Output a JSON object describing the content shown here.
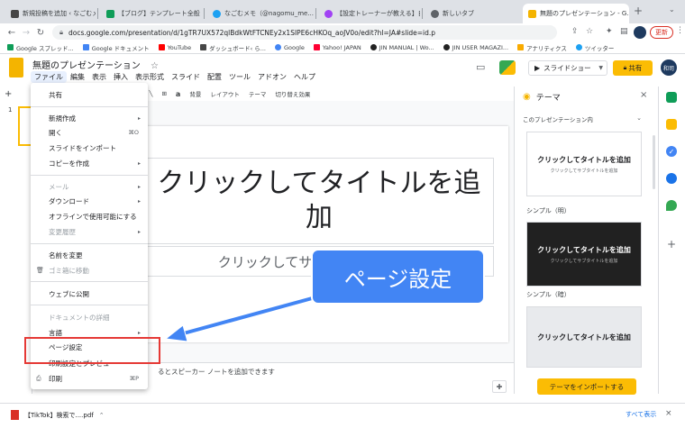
{
  "browser": {
    "tabs": [
      {
        "label": "新規投稿を追加 ‹ なごむメモ —",
        "color": "#464646"
      },
      {
        "label": "【ブログ】テンプレート全般 - ...",
        "color": "#0f9d58"
      },
      {
        "label": "なごむメモ（@nagomu_me...",
        "color": "#1da1f2"
      },
      {
        "label": "【設定トレーナーが教える】自...",
        "color": "#a142f4"
      },
      {
        "label": "新しいタブ",
        "color": "#5f6368"
      },
      {
        "label": "無題のプレゼンテーション - G...",
        "color": "#f4b400"
      }
    ],
    "new_tab": "+",
    "url": "docs.google.com/presentation/d/1gTR7UX572qlBdkWtFTCNEy2x1SIPE6cHKOq_aoJV0o/edit?hl=JA#slide=id.p",
    "update_label": "更新",
    "bookmarks": [
      "Google スプレッド...",
      "Google ドキュメント",
      "YouTube",
      "ダッシュボード‹ ら...",
      "Google",
      "Yahoo! JAPAN",
      "JIN MANUAL | Wo...",
      "JIN USER MAGAZI...",
      "アナリティクス",
      "ツイッター"
    ]
  },
  "app": {
    "title": "無題のプレゼンテーション",
    "menus": [
      "ファイル",
      "編集",
      "表示",
      "挿入",
      "表示形式",
      "スライド",
      "配置",
      "ツール",
      "アドオン",
      "ヘルプ"
    ],
    "slideshow_label": "スライドショー",
    "share_label": "共有",
    "avatar_label": "和司"
  },
  "toolbar": {
    "bg_label": "背景",
    "layout_label": "レイアウト",
    "theme_label": "テーマ",
    "transition_label": "切り替え効果"
  },
  "filmstrip": {
    "slide_number": "1"
  },
  "file_menu": {
    "share": "共有",
    "new": "新規作成",
    "open": "開く",
    "open_shortcut": "⌘O",
    "import": "スライドをインポート",
    "copy": "コピーを作成",
    "email": "メール",
    "download": "ダウンロード",
    "offline": "オフラインで使用可能にする",
    "history": "変更履歴",
    "rename": "名前を変更",
    "trash": "ゴミ箱に移動",
    "publish": "ウェブに公開",
    "details": "ドキュメントの詳細",
    "language": "言語",
    "page_setup": "ページ設定",
    "print_settings": "印刷設定とプレビュー",
    "print": "印刷",
    "print_shortcut": "⌘P"
  },
  "slide": {
    "title_placeholder": "クリックしてタイトルを追加",
    "subtitle_placeholder": "クリックしてサブタイトルを追加"
  },
  "notes_text": "るとスピーカー ノートを追加できます",
  "callout_text": "ページ設定",
  "theme_panel": {
    "title": "テーマ",
    "source": "このプレゼンテーション内",
    "cards": [
      {
        "title": "クリックしてタイトルを追加",
        "sub": "クリックしてサブタイトルを追加",
        "label": "シンプル（明）"
      },
      {
        "title": "クリックしてタイトルを追加",
        "sub": "クリックしてサブタイトルを追加",
        "label": "シンプル（暗）"
      },
      {
        "title": "クリックしてタイトルを追加",
        "sub": "",
        "label": ""
      }
    ],
    "import_label": "テーマをインポートする"
  },
  "downloads": {
    "file": "【TikTok】検索で....pdf",
    "show_all": "すべて表示"
  },
  "colors": {
    "accent_yellow": "#fbbc04",
    "callout_blue": "#4285f4",
    "highlight_red": "#e53935"
  }
}
